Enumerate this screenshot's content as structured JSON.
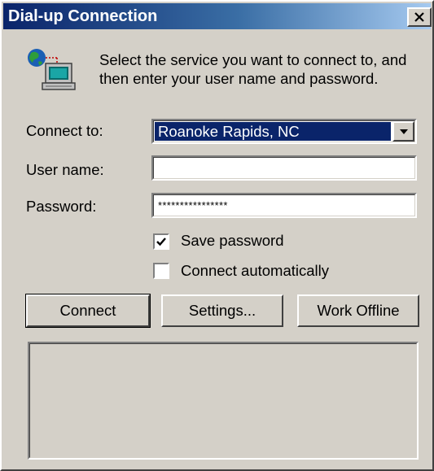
{
  "window": {
    "title": "Dial-up Connection"
  },
  "titlebar": {
    "close_glyph": "X"
  },
  "icon": "network-computer-icon",
  "intro": {
    "text": "Select the service you want to connect to, and then enter your user name and password."
  },
  "form": {
    "connect_to": {
      "label": "Connect to:",
      "value": "Roanoke Rapids, NC"
    },
    "user_name": {
      "label": "User name:",
      "value": ""
    },
    "password": {
      "label": "Password:",
      "value": "****************"
    }
  },
  "checkboxes": {
    "save_password": {
      "label": "Save password",
      "checked": true
    },
    "connect_automatically": {
      "label": "Connect automatically",
      "checked": false
    }
  },
  "buttons": {
    "connect": "Connect",
    "settings": "Settings...",
    "work_offline": "Work Offline"
  },
  "colors": {
    "face": "#d4d0c8",
    "title_active": "#0a246a",
    "selection": "#0a246a"
  }
}
